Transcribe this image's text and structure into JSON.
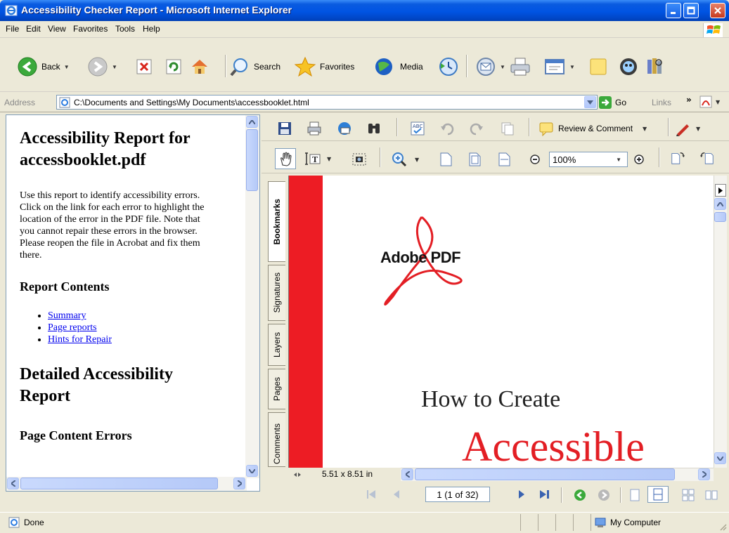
{
  "window": {
    "title": "Accessibility Checker Report - Microsoft Internet Explorer",
    "controls": [
      "minimize",
      "maximize",
      "close"
    ]
  },
  "menu": [
    "File",
    "Edit",
    "View",
    "Favorites",
    "Tools",
    "Help"
  ],
  "toolbar": {
    "back_label": "Back",
    "search_label": "Search",
    "favorites_label": "Favorites",
    "media_label": "Media",
    "icons": [
      "back-icon",
      "forward-icon",
      "stop-icon",
      "refresh-icon",
      "home-icon",
      "search-icon",
      "favorites-icon",
      "media-icon",
      "history-icon",
      "mail-icon",
      "print-icon",
      "edit-icon",
      "discuss-icon",
      "messenger-icon",
      "research-icon"
    ]
  },
  "address": {
    "label": "Address",
    "value": "C:\\Documents and Settings\\My Documents\\accessbooklet.html",
    "go_label": "Go",
    "links_label": "Links"
  },
  "report": {
    "title": "Accessibility Report for accessbooklet.pdf",
    "intro_lines": [
      "Use this report to identify accessibility errors.",
      "Click on the link for each error to highlight the",
      "location of the error in the PDF file. Note that",
      "you cannot repair these errors in the browser.",
      "Please reopen the file in Acrobat and fix them",
      "there."
    ],
    "contents_heading": "Report Contents",
    "links": [
      "Summary",
      "Page reports",
      "Hints for Repair"
    ],
    "detailed_heading": "Detailed Accessibility Report",
    "page_errors_heading": "Page Content Errors"
  },
  "acrobat": {
    "review_label": "Review & Comment",
    "zoom_value": "100%",
    "nav_tabs": [
      "Bookmarks",
      "Signatures",
      "Layers",
      "Pages",
      "Comments"
    ],
    "page_size": "5.51 x 8.51 in",
    "page_indicator": "1  (1 of 32)",
    "document": {
      "logo_text": "Adobe PDF",
      "line1": "How to Create",
      "line2": "Accessible"
    },
    "colors": {
      "accent_red": "#ED1C24"
    }
  },
  "status": {
    "text": "Done",
    "zone": "My Computer"
  }
}
